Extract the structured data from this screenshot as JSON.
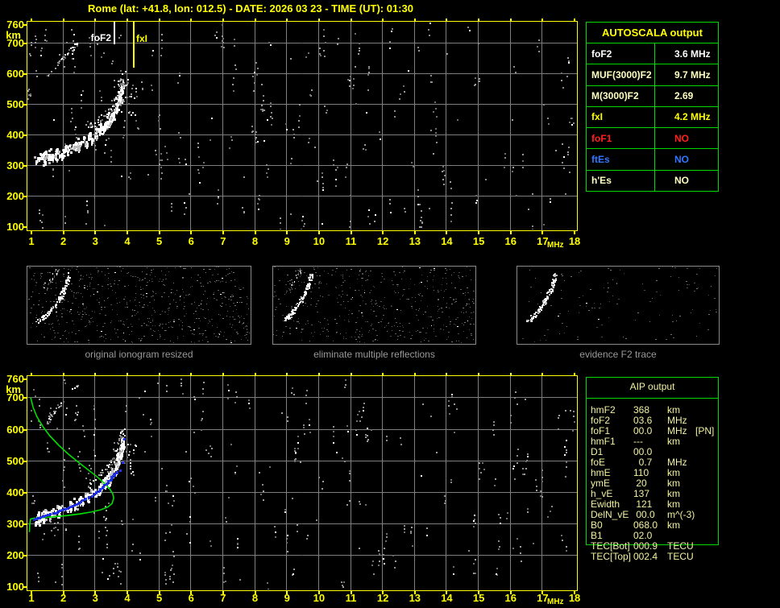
{
  "title": "Rome (lat: +41.8, lon: 012.5) - DATE: 2026 03 23 - TIME (UT): 01:30",
  "colors": {
    "accent_yellow": "#ffff00",
    "cream": "#ffffc0",
    "pale_yellow": "#f2f2a0",
    "grid_gray": "#7d7d7d",
    "table_green": "#00d800",
    "profile_green": "#00dd00",
    "fitted_blue": "#2233ee",
    "noise_gray": "#8a8a8a",
    "thumb_border": "#8a8a8a",
    "caption_gray": "#9a9a9a",
    "white": "#ffffff",
    "red": "#ff2020",
    "blue": "#3377ff"
  },
  "axes": {
    "x_ticks": [
      "1",
      "2",
      "3",
      "4",
      "5",
      "6",
      "7",
      "8",
      "9",
      "10",
      "11",
      "12",
      "13",
      "14",
      "15",
      "16",
      "17",
      "18"
    ],
    "y_ticks": [
      "760",
      "700",
      "600",
      "500",
      "400",
      "300",
      "200",
      "100"
    ],
    "y_tick_values": [
      760,
      700,
      600,
      500,
      400,
      300,
      200,
      100
    ],
    "x_unit": "MHz",
    "y_unit": "km"
  },
  "autoscala": {
    "header": "AUTOSCALA output",
    "rows": [
      {
        "label": "foF2",
        "value": "3.6 MHz",
        "color": "#ffffff"
      },
      {
        "label": "MUF(3000)F2",
        "value": "9.7 MHz",
        "color": "#ffffc0"
      },
      {
        "label": "M(3000)F2",
        "value": "2.69",
        "color": "#ffffc0"
      },
      {
        "label": "fxI",
        "value": "4.2 MHz",
        "color": "#ffff00"
      },
      {
        "label": "foF1",
        "value": "NO",
        "color": "#ff2020"
      },
      {
        "label": "ftEs",
        "value": "NO",
        "color": "#3377ff"
      },
      {
        "label": "h'Es",
        "value": "NO",
        "color": "#ffffc0"
      }
    ]
  },
  "aip": {
    "header": "AIP output",
    "rows": [
      {
        "label": "hmF2",
        "value": "368",
        "unit": "km",
        "note": ""
      },
      {
        "label": "foF2",
        "value": "03.6",
        "unit": "MHz",
        "note": ""
      },
      {
        "label": "foF1",
        "value": "00.0",
        "unit": "MHz",
        "note": "[PN]"
      },
      {
        "label": "hmF1",
        "value": "---",
        "unit": "km",
        "note": ""
      },
      {
        "label": "D1",
        "value": "00.0",
        "unit": "",
        "note": ""
      },
      {
        "label": "foE",
        "value": "  0.7",
        "unit": "MHz",
        "note": ""
      },
      {
        "label": "hmE",
        "value": "110",
        "unit": "km",
        "note": ""
      },
      {
        "label": "ymE",
        "value": " 20",
        "unit": "km",
        "note": ""
      },
      {
        "label": "h_vE",
        "value": "137",
        "unit": "km",
        "note": ""
      },
      {
        "label": "Ewidth",
        "value": " 121",
        "unit": "km",
        "note": ""
      },
      {
        "label": "DelN_vE",
        "value": " 00.0",
        "unit": "m^(-3)",
        "note": ""
      },
      {
        "label": "B0",
        "value": "068.0",
        "unit": "km",
        "note": ""
      },
      {
        "label": "B1",
        "value": "02.0",
        "unit": "",
        "note": ""
      },
      {
        "label": "TEC[Bot]",
        "value": "000.9",
        "unit": "TECU",
        "note": ""
      },
      {
        "label": "TEC[Top]",
        "value": "002.4",
        "unit": "TECU",
        "note": ""
      }
    ]
  },
  "thumbnails": [
    {
      "caption": "original ionogram resized",
      "noise_dots": 640,
      "has_multiple": true
    },
    {
      "caption": "eliminate multiple reflections",
      "noise_dots": 480,
      "has_multiple": true
    },
    {
      "caption": "evidence F2 trace",
      "noise_dots": 115,
      "has_multiple": false
    }
  ],
  "markers": {
    "foF2_label": "foF2",
    "foF2_mhz": 3.6,
    "fxI_label": "fxI",
    "fxI_mhz": 4.2
  },
  "chart_data": [
    {
      "type": "scatter",
      "title": "top ionogram (virtual height vs frequency)",
      "xlabel": "MHz",
      "ylabel": "km",
      "xlim": [
        1,
        18
      ],
      "ylim": [
        100,
        760
      ],
      "grid": true,
      "markers": {
        "foF2": 3.6,
        "fxI": 4.2
      },
      "f2_trace": [
        [
          1.12,
          314
        ],
        [
          1.3,
          321
        ],
        [
          1.5,
          328
        ],
        [
          1.75,
          337
        ],
        [
          2.0,
          347
        ],
        [
          2.25,
          358
        ],
        [
          2.5,
          371
        ],
        [
          2.75,
          386
        ],
        [
          3.0,
          403
        ],
        [
          3.2,
          420
        ],
        [
          3.38,
          439
        ],
        [
          3.52,
          460
        ],
        [
          3.64,
          483
        ],
        [
          3.73,
          507
        ],
        [
          3.8,
          530
        ],
        [
          3.85,
          550
        ],
        [
          3.88,
          565
        ]
      ],
      "multiple_trace": [
        [
          1.5,
          588
        ],
        [
          1.75,
          620
        ],
        [
          2.0,
          650
        ],
        [
          2.25,
          678
        ],
        [
          2.45,
          700
        ]
      ],
      "spread_cluster": {
        "f_range": [
          3.8,
          4.35
        ],
        "km_range": [
          460,
          585
        ],
        "count": 26
      },
      "noise": {
        "seed": 7,
        "clusters": 205,
        "white_fraction": 0.1
      }
    },
    {
      "type": "scatter",
      "title": "bottom ionogram with AIP electron density profile and fitted trace",
      "xlabel": "MHz",
      "ylabel": "km",
      "xlim": [
        1,
        18
      ],
      "ylim": [
        100,
        760
      ],
      "grid": true,
      "f2_trace": [
        [
          1.12,
          314
        ],
        [
          1.3,
          321
        ],
        [
          1.5,
          328
        ],
        [
          1.75,
          337
        ],
        [
          2.0,
          347
        ],
        [
          2.25,
          358
        ],
        [
          2.5,
          371
        ],
        [
          2.75,
          386
        ],
        [
          3.0,
          403
        ],
        [
          3.2,
          420
        ],
        [
          3.38,
          439
        ],
        [
          3.52,
          460
        ],
        [
          3.64,
          483
        ],
        [
          3.73,
          507
        ],
        [
          3.8,
          530
        ],
        [
          3.85,
          550
        ],
        [
          3.88,
          565
        ]
      ],
      "multiple_trace": [
        [
          1.45,
          620
        ],
        [
          1.72,
          655
        ],
        [
          2.0,
          690
        ],
        [
          2.3,
          725
        ],
        [
          2.5,
          746
        ]
      ],
      "spread_cluster": {
        "f_range": [
          3.8,
          4.3
        ],
        "km_range": [
          450,
          560
        ],
        "count": 22
      },
      "profile_green": [
        [
          1.0,
          700
        ],
        [
          1.08,
          668
        ],
        [
          1.2,
          638
        ],
        [
          1.38,
          608
        ],
        [
          1.6,
          578
        ],
        [
          1.88,
          548
        ],
        [
          2.18,
          520
        ],
        [
          2.5,
          494
        ],
        [
          2.8,
          470
        ],
        [
          3.08,
          448
        ],
        [
          3.3,
          428
        ],
        [
          3.47,
          410
        ],
        [
          3.57,
          394
        ],
        [
          3.6,
          380
        ],
        [
          3.55,
          363
        ],
        [
          3.42,
          352
        ],
        [
          3.2,
          343
        ],
        [
          2.9,
          336
        ],
        [
          2.55,
          330
        ],
        [
          2.15,
          325
        ],
        [
          1.75,
          321
        ],
        [
          1.4,
          318
        ],
        [
          1.1,
          316
        ],
        [
          1.0,
          314
        ],
        [
          0.97,
          295
        ],
        [
          0.96,
          272
        ]
      ],
      "fitted_trace_blue": [
        [
          1.05,
          316
        ],
        [
          1.3,
          323
        ],
        [
          1.6,
          332
        ],
        [
          1.9,
          343
        ],
        [
          2.2,
          355
        ],
        [
          2.5,
          369
        ],
        [
          2.78,
          385
        ],
        [
          3.02,
          401
        ],
        [
          3.22,
          417
        ],
        [
          3.4,
          435
        ],
        [
          3.55,
          452
        ],
        [
          3.66,
          466
        ]
      ],
      "fitted_isolated_blue": [
        [
          3.78,
          470
        ],
        [
          3.86,
          497
        ],
        [
          3.9,
          570
        ]
      ],
      "noise": {
        "seed": 13,
        "clusters": 205,
        "white_fraction": 0.09
      }
    },
    {
      "type": "scatter",
      "title": "thumbnail trace (fractional coords)",
      "trace_frac": [
        [
          0.05,
          0.7
        ],
        [
          0.075,
          0.64
        ],
        [
          0.1,
          0.57
        ],
        [
          0.12,
          0.5
        ],
        [
          0.14,
          0.42
        ],
        [
          0.155,
          0.34
        ],
        [
          0.168,
          0.26
        ],
        [
          0.178,
          0.17
        ],
        [
          0.185,
          0.1
        ]
      ],
      "multiple_frac": [
        [
          0.08,
          0.3
        ],
        [
          0.1,
          0.2
        ],
        [
          0.12,
          0.1
        ],
        [
          0.135,
          0.03
        ]
      ]
    }
  ]
}
